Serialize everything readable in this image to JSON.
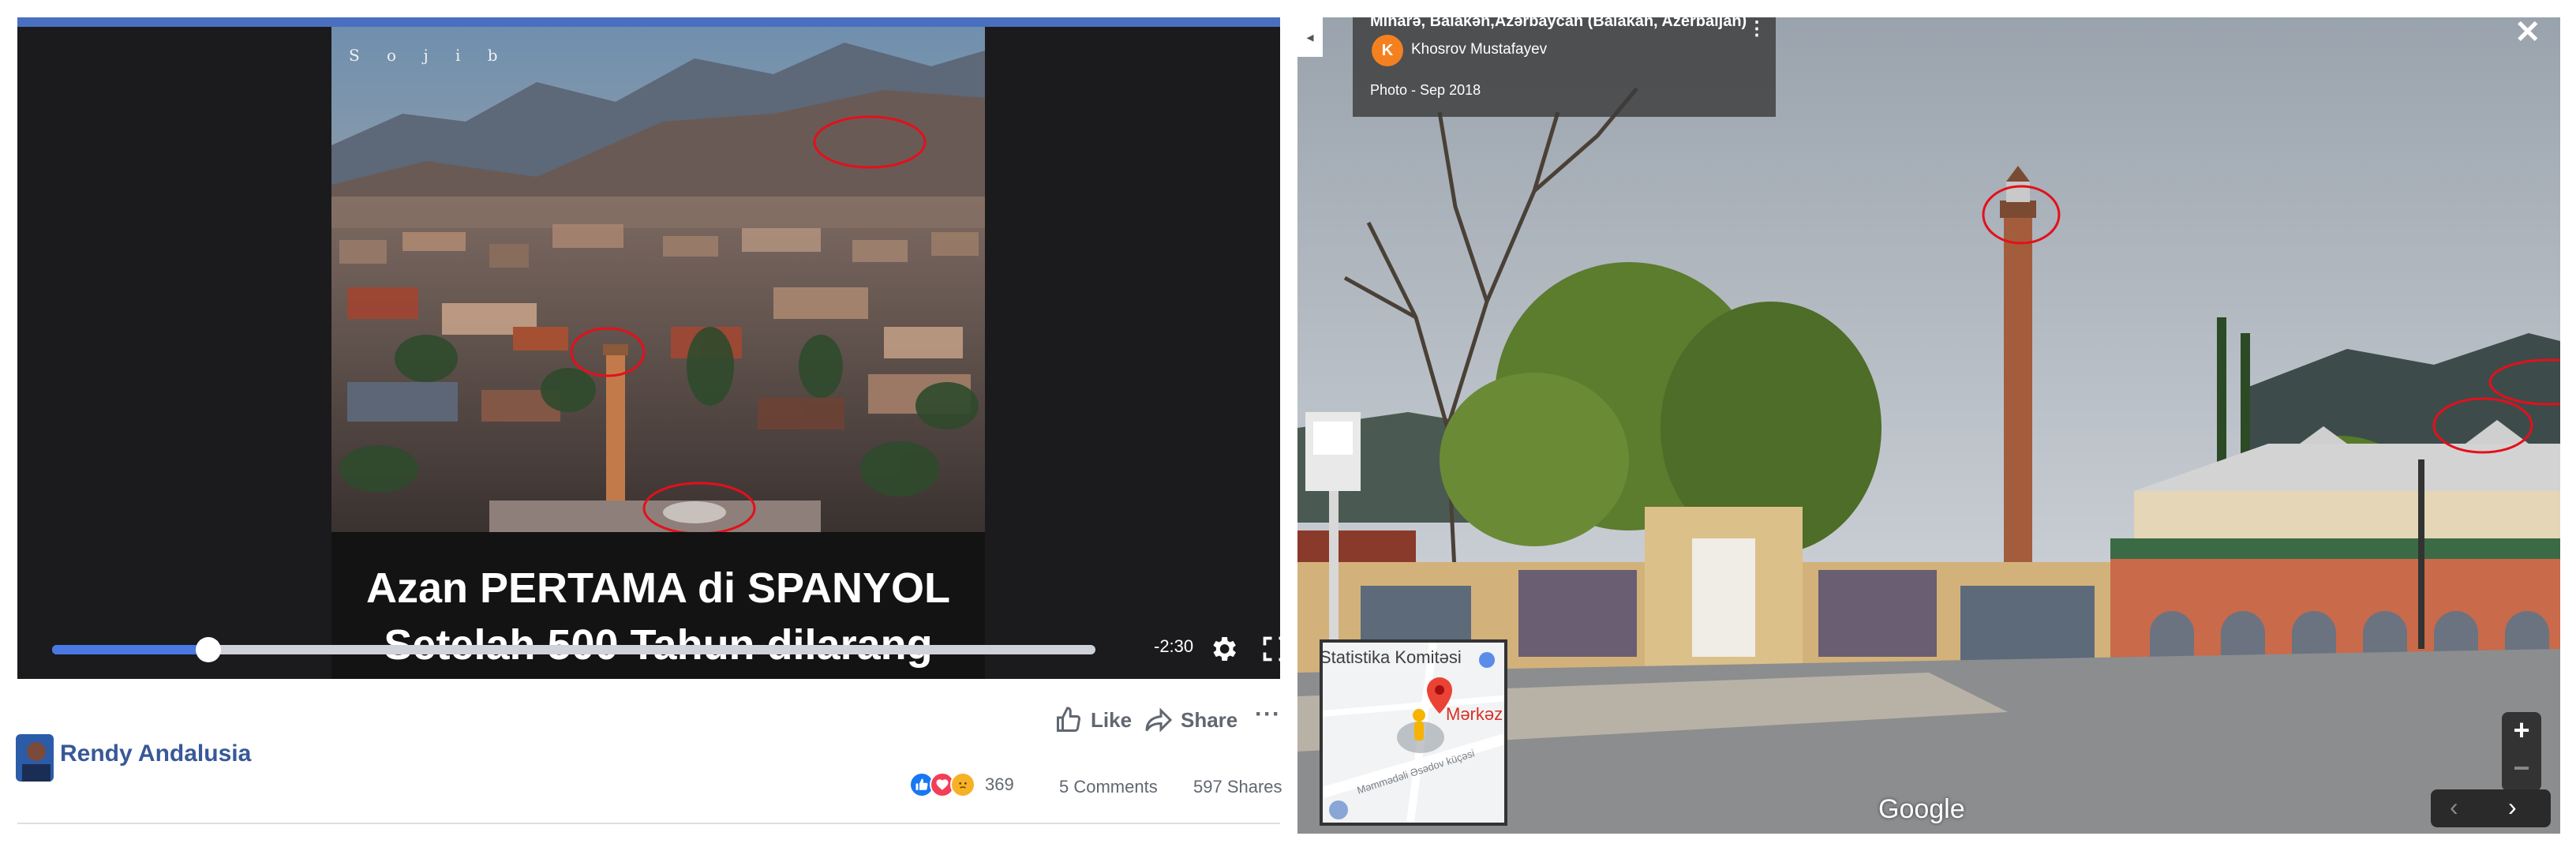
{
  "facebook_post": {
    "video": {
      "watermark": "S o j i b",
      "caption_line_1": "Azan PERTAMA di SPANYOL",
      "caption_line_2": "Setelah 500 Tahun dilarang",
      "time_remaining": "-2:30",
      "progress_fraction": 0.15
    },
    "actions": {
      "like_label": "Like",
      "share_label": "Share",
      "more_label": "···"
    },
    "author": {
      "name": "Rendy Andalusia"
    },
    "stats": {
      "reactions_count": "369",
      "comments": "5 Comments",
      "shares": "597 Shares"
    },
    "colors": {
      "link_blue": "#385898",
      "progress_blue": "#4a79e3",
      "annotation_red": "#e3101b"
    }
  },
  "street_view": {
    "info_card": {
      "place": "Minarə, Balakən,Azərbaycan (Balakan, Azerbaijan)",
      "author_initial": "K",
      "author_name": "Khosrov Mustafayev",
      "photo_date": "Photo - Sep 2018"
    },
    "close_label": "✕",
    "back_label": "◂",
    "minimap": {
      "label_top": "Statistika Komitəsi",
      "pin_label": "Mərkəz",
      "road_label": "Məmmədəli Əsədov küçəsi"
    },
    "google_logo": "Google",
    "zoom": {
      "in": "+",
      "out": "−"
    },
    "nav": {
      "prev": "‹",
      "next": "›"
    }
  }
}
